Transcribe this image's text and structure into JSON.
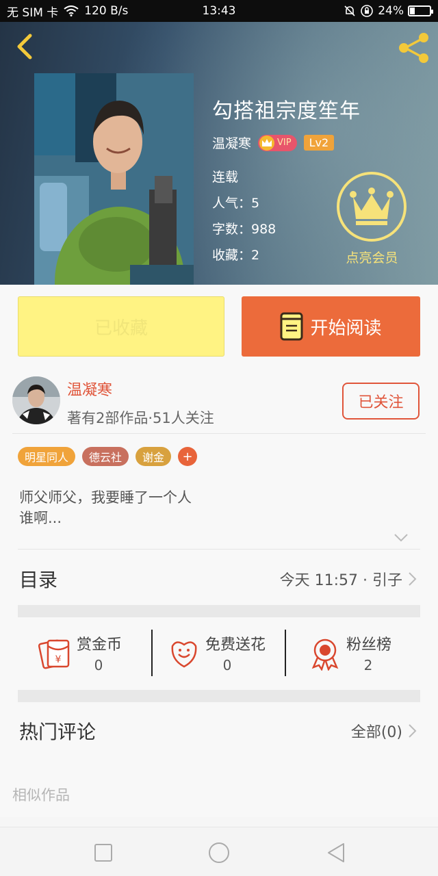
{
  "status_bar": {
    "carrier": "无 SIM 卡",
    "speed": "120 B/s",
    "time": "13:43",
    "battery": "24%",
    "battery_level": 0.24
  },
  "book": {
    "title": "勾搭祖宗度笙年",
    "author": "温凝寒",
    "vip": "VIP",
    "level": "Lv2",
    "status": "连载",
    "popularity": "人气：5",
    "words": "字数：988",
    "favorites": "收藏：2"
  },
  "vip_member": {
    "label": "点亮会员"
  },
  "actions": {
    "collected": "已收藏",
    "start_reading": "开始阅读"
  },
  "author_card": {
    "name": "温凝寒",
    "stats": "著有2部作品·51人关注",
    "follow": "已关注"
  },
  "tags": [
    {
      "label": "明星同人",
      "color": "#f0a33a"
    },
    {
      "label": "德云社",
      "color": "#c8705e"
    },
    {
      "label": "谢金",
      "color": "#d8a13e"
    }
  ],
  "tag_add": "+",
  "description": {
    "line1": "师父师父，我要睡了一个人",
    "line2": "谁啊..."
  },
  "catalog": {
    "title": "目录",
    "latest": "今天 11:57 · 引子"
  },
  "stats": [
    {
      "label": "赏金币",
      "value": "0",
      "icon": "red-envelope-icon"
    },
    {
      "label": "免费送花",
      "value": "0",
      "icon": "flower-icon"
    },
    {
      "label": "粉丝榜",
      "value": "2",
      "icon": "medal-icon"
    }
  ],
  "comments": {
    "title": "热门评论",
    "all": "全部(0)"
  },
  "similar": "相似作品",
  "colors": {
    "accent_orange": "#ec6b3b",
    "collected_yellow": "#fff383",
    "author_red": "#e0553a",
    "gold": "#f6e27a"
  }
}
